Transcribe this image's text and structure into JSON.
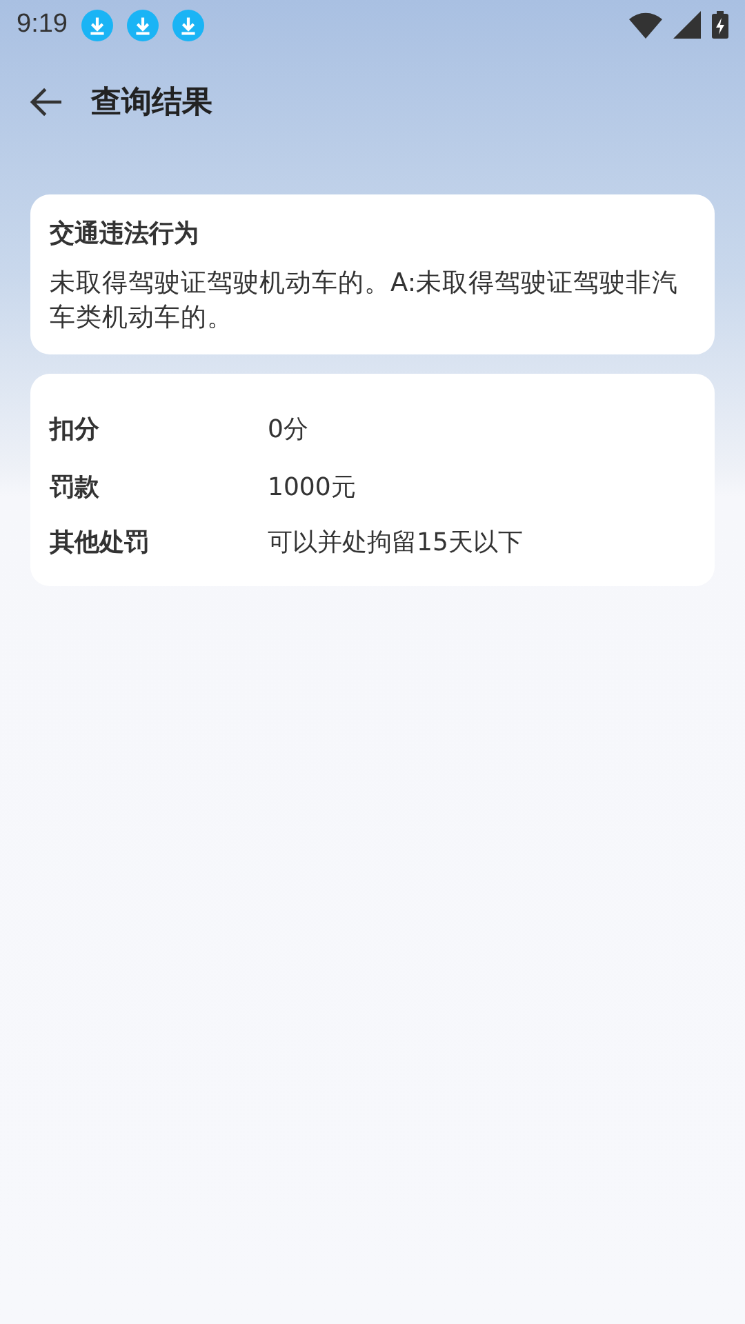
{
  "status_bar": {
    "time": "9:19",
    "notifications": [
      {
        "kind": "download"
      },
      {
        "kind": "download"
      },
      {
        "kind": "download"
      }
    ]
  },
  "title": "查询结果",
  "violation": {
    "heading": "交通违法行为",
    "text": "未取得驾驶证驾驶机动车的。A:未取得驾驶证驾驶非汽车类机动车的。"
  },
  "details": [
    {
      "label": "扣分",
      "value": "0分"
    },
    {
      "label": "罚款",
      "value": "1000元"
    },
    {
      "label": "其他处罚",
      "value": "可以并处拘留15天以下"
    }
  ]
}
